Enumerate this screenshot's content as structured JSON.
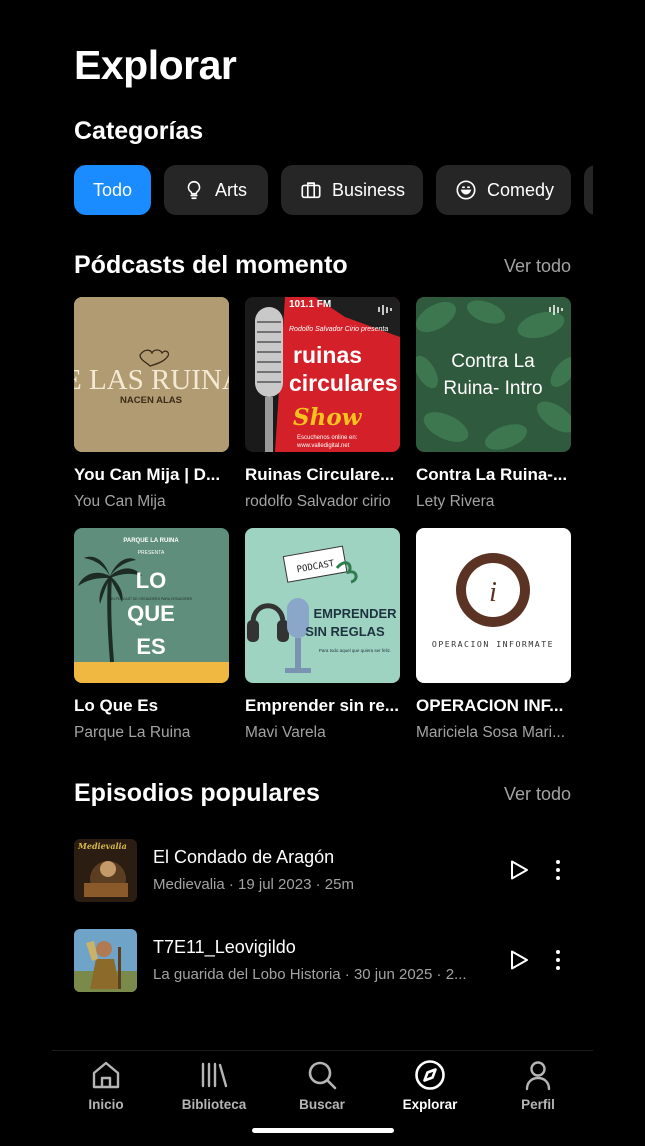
{
  "page": {
    "title": "Explorar"
  },
  "categories": {
    "title": "Categorías",
    "chips": [
      {
        "label": "Todo",
        "icon": "",
        "active": true
      },
      {
        "label": "Arts",
        "icon": "lightbulb-icon",
        "active": false
      },
      {
        "label": "Business",
        "icon": "briefcase-icon",
        "active": false
      },
      {
        "label": "Comedy",
        "icon": "smile-icon",
        "active": false
      }
    ]
  },
  "trending": {
    "title": "Pódcasts del momento",
    "see_all": "Ver todo",
    "podcasts": [
      {
        "title": "You Can Mija | D...",
        "author": "You Can Mija",
        "cover_line1": "DE LAS RUINAS",
        "cover_line2": "NACEN ALAS"
      },
      {
        "title": "Ruinas Circulare...",
        "author": "rodolfo Salvador cirio",
        "cover_top": "101.1 FM",
        "cover_pre": "Rodolfo Salvador Cirio presenta",
        "cover_line1": "ruinas",
        "cover_line2": "circulares",
        "cover_line3": "Show",
        "cover_foot1": "Escuchenos online en:",
        "cover_foot2": "www.valledigital.net"
      },
      {
        "title": "Contra La Ruina-...",
        "author": "Lety Rivera",
        "cover_line1": "Contra La",
        "cover_line2": "Ruina- Intro"
      },
      {
        "title": "Lo Que Es",
        "author": "Parque La Ruina",
        "cover_top": "PARQUE LA RUINA",
        "cover_pre": "PRESENTA",
        "cover_line1": "LO",
        "cover_line2": "QUE",
        "cover_line3": "ES",
        "cover_small": "UN PODCAST DE CREADORES PARA CREADORES"
      },
      {
        "title": "Emprender sin re...",
        "author": "Mavi Varela",
        "cover_tag": "PODCAST",
        "cover_line1": "EMPRENDER",
        "cover_line2": "SIN REGLAS",
        "cover_small": "Para todo aquel que quiera ser feliz."
      },
      {
        "title": "OPERACION INF...",
        "author": "Mariciela Sosa Mari...",
        "cover_letter": "i",
        "cover_line1": "OPERACION INFORMATE"
      }
    ]
  },
  "popular": {
    "title": "Episodios populares",
    "see_all": "Ver todo",
    "episodes": [
      {
        "title": "El Condado de Aragón",
        "meta": "Medievalia · 19 jul 2023 · 25m",
        "thumb_text": "Medievalia"
      },
      {
        "title": "T7E11_Leovigildo",
        "meta": "La guarida del Lobo Historia · 30 jun 2025 · 2..."
      }
    ]
  },
  "nav": {
    "items": [
      {
        "label": "Inicio",
        "icon": "home-icon",
        "active": false
      },
      {
        "label": "Biblioteca",
        "icon": "library-icon",
        "active": false
      },
      {
        "label": "Buscar",
        "icon": "search-icon",
        "active": false
      },
      {
        "label": "Explorar",
        "icon": "compass-icon",
        "active": true
      },
      {
        "label": "Perfil",
        "icon": "person-icon",
        "active": false
      }
    ]
  },
  "colors": {
    "accent": "#1a8cff",
    "background": "#000000",
    "chip": "#262626",
    "secondary_text": "#a3a3a3"
  }
}
